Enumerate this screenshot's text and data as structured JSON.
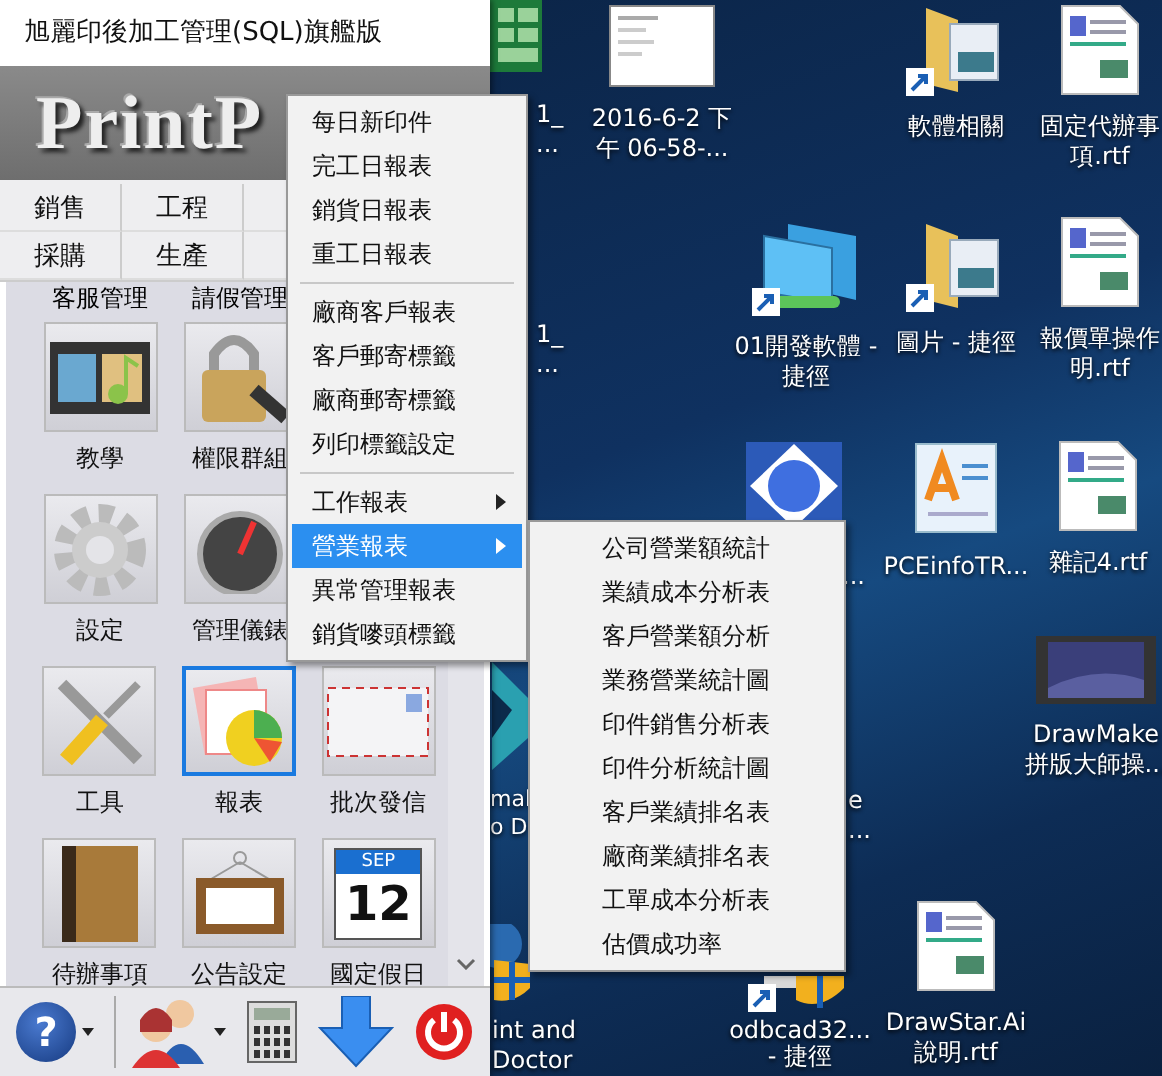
{
  "desktop_icons": [
    {
      "kind": "sheet"
    },
    {
      "kind": "hidden",
      "label": [
        "1_",
        "..."
      ]
    },
    {
      "kind": "thumb",
      "label": [
        "2016-6-2 下",
        "午 06-58-..."
      ]
    },
    {
      "kind": "folder",
      "label": [
        "軟體相關"
      ]
    },
    {
      "kind": "doc",
      "label": [
        "固定代辦事",
        "項.rtf"
      ]
    },
    {
      "kind": "hidden",
      "label": [
        "1_",
        "..."
      ]
    },
    {
      "kind": "network",
      "label": [
        "01開發軟體 -",
        "捷徑"
      ]
    },
    {
      "kind": "folder",
      "label": [
        "圖片 - 捷徑"
      ]
    },
    {
      "kind": "doc",
      "label": [
        "報價單操作",
        "明.rtf"
      ]
    },
    {
      "kind": "diamond"
    },
    {
      "kind": "hidden",
      "label": [
        "..."
      ]
    },
    {
      "kind": "wordpad",
      "label": [
        "PCEinfoTR..."
      ]
    },
    {
      "kind": "doc",
      "label": [
        "雜記4.rtf"
      ]
    },
    {
      "kind": "hidden",
      "label": [
        "e",
        "..."
      ]
    },
    {
      "kind": "teal"
    },
    {
      "kind": "hidden",
      "label": [
        "mal",
        "o D"
      ]
    },
    {
      "kind": "video",
      "label": [
        "DrawMake",
        "拼版大師操..."
      ]
    },
    {
      "kind": "hp"
    },
    {
      "kind": "hidden",
      "label": [
        "int and",
        "Doctor"
      ]
    },
    {
      "kind": "setup",
      "label": [
        "odbcad32...",
        "- 捷徑"
      ]
    },
    {
      "kind": "doc",
      "label": [
        "DrawStar.Ai",
        "說明.rtf"
      ]
    }
  ],
  "window": {
    "title": "旭麗印後加工管理(SQL)旗艦版",
    "logo": "PrintP",
    "nav": [
      [
        "銷售",
        "工程"
      ],
      [
        "採購",
        "生產"
      ]
    ],
    "cut_row": [
      "客服管理",
      "請假管理"
    ],
    "tile_rows": [
      [
        {
          "label": "教學",
          "kind": "film",
          "selected": false
        },
        {
          "label": "權限群組",
          "kind": "lock",
          "selected": false
        }
      ],
      [
        {
          "label": "設定",
          "kind": "gear",
          "selected": false
        },
        {
          "label": "管理儀錶",
          "kind": "gauge",
          "selected": false
        }
      ],
      [
        {
          "label": "工具",
          "kind": "tools",
          "selected": false
        },
        {
          "label": "報表",
          "kind": "report",
          "selected": true
        },
        {
          "label": "批次發信",
          "kind": "mail",
          "selected": false
        }
      ],
      [
        {
          "label": "待辦事項",
          "kind": "book",
          "selected": false
        },
        {
          "label": "公告設定",
          "kind": "board",
          "selected": false
        },
        {
          "label": "國定假日",
          "kind": "calendar",
          "selected": false,
          "month": "SEP",
          "day": "12"
        }
      ]
    ],
    "toolbar": [
      {
        "kind": "help",
        "glyph": "?"
      },
      {
        "kind": "users"
      },
      {
        "kind": "calculator"
      },
      {
        "kind": "download"
      },
      {
        "kind": "power"
      }
    ]
  },
  "menu": [
    {
      "kind": "item",
      "label": "每日新印件",
      "submenu": false,
      "selected": false
    },
    {
      "kind": "item",
      "label": "完工日報表",
      "submenu": false,
      "selected": false
    },
    {
      "kind": "item",
      "label": "銷貨日報表",
      "submenu": false,
      "selected": false
    },
    {
      "kind": "item",
      "label": "重工日報表",
      "submenu": false,
      "selected": false
    },
    {
      "kind": "separator"
    },
    {
      "kind": "item",
      "label": "廠商客戶報表",
      "submenu": false,
      "selected": false
    },
    {
      "kind": "item",
      "label": "客戶郵寄標籤",
      "submenu": false,
      "selected": false
    },
    {
      "kind": "item",
      "label": "廠商郵寄標籤",
      "submenu": false,
      "selected": false
    },
    {
      "kind": "item",
      "label": "列印標籤設定",
      "submenu": false,
      "selected": false
    },
    {
      "kind": "separator"
    },
    {
      "kind": "item",
      "label": "工作報表",
      "submenu": true,
      "selected": false
    },
    {
      "kind": "item",
      "label": "營業報表",
      "submenu": true,
      "selected": true
    },
    {
      "kind": "item",
      "label": "異常管理報表",
      "submenu": false,
      "selected": false
    },
    {
      "kind": "item",
      "label": "銷貨嘜頭標籤",
      "submenu": false,
      "selected": false
    }
  ],
  "submenu": [
    "公司營業額統計",
    "業績成本分析表",
    "客戶營業額分析",
    "業務營業統計圖",
    "印件銷售分析表",
    "印件分析統計圖",
    "客戶業績排名表",
    "廠商業績排名表",
    "工單成本分析表",
    "估價成功率"
  ]
}
